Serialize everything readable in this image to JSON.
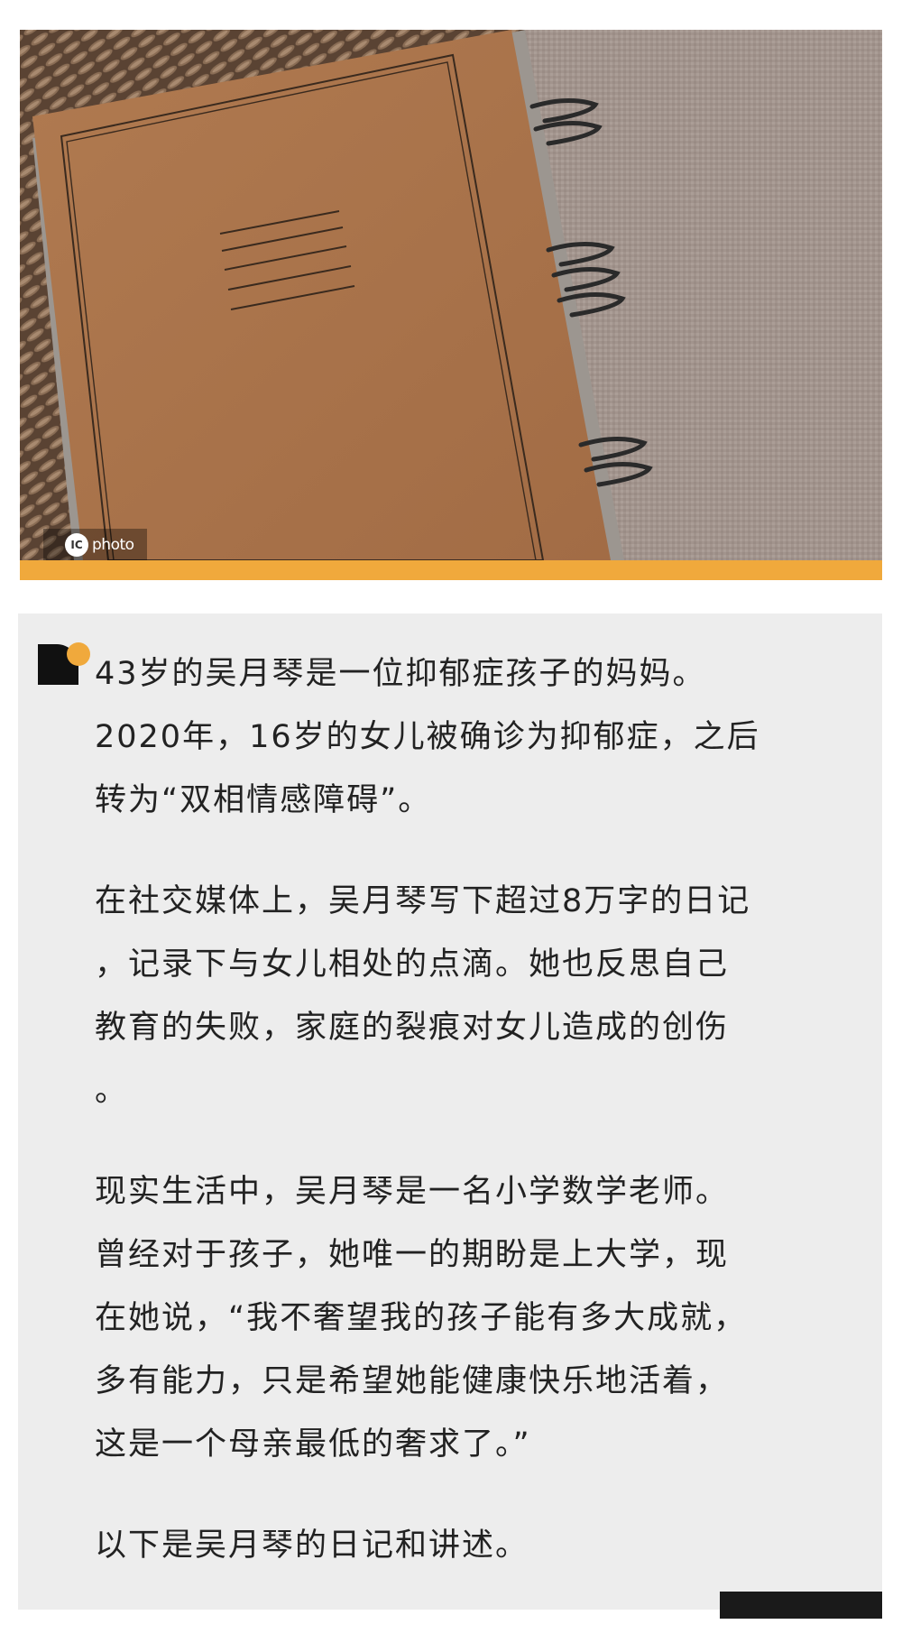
{
  "hero": {
    "watermark_icon": "IC",
    "watermark_text": "photo"
  },
  "colors": {
    "accent": "#f0a93c",
    "card_bg": "#ededed",
    "text": "#222222"
  },
  "article": {
    "paragraphs": [
      "43岁的吴月琴是一位抑郁症孩子的妈妈。\n2020年，16岁的女儿被确诊为抑郁症，之后\n转为“双相情感障碍”。",
      "在社交媒体上，吴月琴写下超过8万字的日记\n，记录下与女儿相处的点滴。她也反思自己\n教育的失败，家庭的裂痕对女儿造成的创伤\n。",
      "现实生活中，吴月琴是一名小学数学老师。\n曾经对于孩子，她唯一的期盼是上大学，现\n在她说，“我不奢望我的孩子能有多大成就，\n多有能力，只是希望她能健康快乐地活着，\n这是一个母亲最低的奢求了。”",
      "以下是吴月琴的日记和讲述。"
    ]
  }
}
